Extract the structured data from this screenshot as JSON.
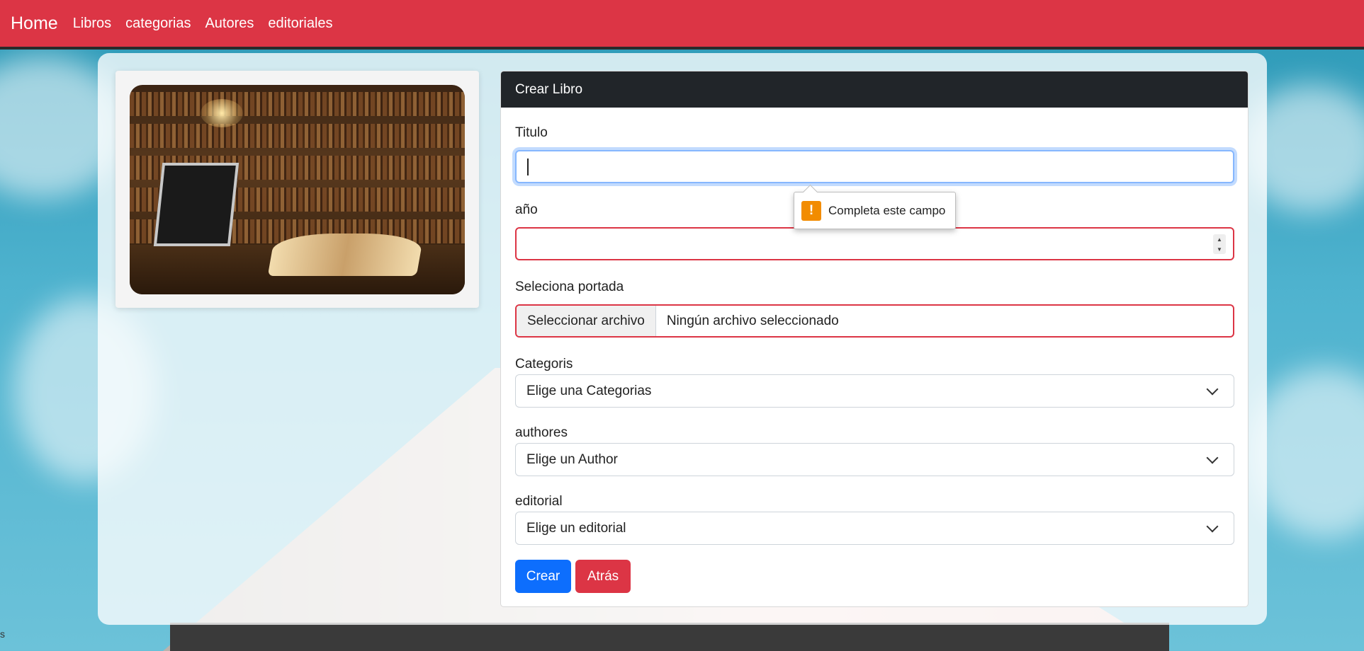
{
  "navbar": {
    "brand": "Home",
    "links": [
      "Libros",
      "categorias",
      "Autores",
      "editoriales"
    ]
  },
  "form": {
    "header": "Crear Libro",
    "titulo_label": "Titulo",
    "titulo_value": "",
    "anio_label": "año",
    "anio_value": "",
    "portada_label": "Seleciona portada",
    "file_button": "Seleccionar archivo",
    "file_status": "Ningún archivo seleccionado",
    "categoria_label": "Categoris",
    "categoria_selected": "Elige una Categorias",
    "autor_label": "authores",
    "autor_selected": "Elige un Author",
    "editorial_label": "editorial",
    "editorial_selected": "Elige un editorial",
    "submit_label": "Crear",
    "back_label": "Atrás"
  },
  "validation_tooltip": {
    "icon": "warning-icon",
    "text": "Completa este campo"
  },
  "stray_text": "s",
  "colors": {
    "navbar": "#dc3545",
    "header": "#212529",
    "primary": "#0d6efd",
    "danger": "#dc3545",
    "warning": "#f28c00"
  }
}
